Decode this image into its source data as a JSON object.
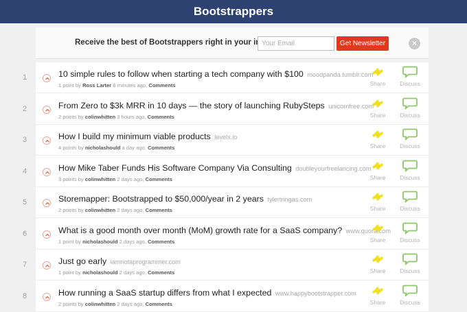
{
  "header": {
    "title": "Bootstrappers"
  },
  "newsletter": {
    "text": "Receive the best of Bootstrappers right in your inbox",
    "email_placeholder": "Your Email",
    "button_label": "Get Newsletter",
    "close_glyph": "×"
  },
  "actions": {
    "share_label": "Share",
    "discuss_label": "Discuss"
  },
  "colors": {
    "header_bg": "#2e4272",
    "newsletter_button": "#e03a1e",
    "share_icon": "#f0e020",
    "discuss_icon": "#8dc76a",
    "upvote_icon": "#e3623f"
  },
  "icons": {
    "upvote": "chevron-up-icon",
    "share": "share-arrows-icon",
    "discuss": "speech-bubble-icon",
    "close": "close-icon"
  },
  "posts": [
    {
      "rank": "1",
      "title": "10 simple rules to follow when starting a tech company with $100",
      "domain": "moodpanda.tumblr.com",
      "points": "1 point by",
      "author": "Ross Larter",
      "time": "6 minutes ago",
      "comments": "Comments"
    },
    {
      "rank": "2",
      "title": "From Zero to $3k MRR in 10 days — the story of launching RubySteps",
      "domain": "unicornfree.com",
      "points": "2 points by",
      "author": "colinwhitten",
      "time": "3 hours ago",
      "comments": "Comments"
    },
    {
      "rank": "3",
      "title": "How I build my minimum viable products",
      "domain": "levels.io",
      "points": "4 points by",
      "author": "nicholashould",
      "time": "a day ago",
      "comments": "Comments"
    },
    {
      "rank": "4",
      "title": "How Mike Taber Funds His Software Company Via Consulting",
      "domain": "doubleyourfreelancing.com",
      "points": "3 points by",
      "author": "colinwhitten",
      "time": "2 days ago",
      "comments": "Comments"
    },
    {
      "rank": "5",
      "title": "Storemapper: Bootstrapped to $50,000/year in 2 years",
      "domain": "tylertringas.com",
      "points": "2 points by",
      "author": "colinwhitten",
      "time": "2 days ago",
      "comments": "Comments"
    },
    {
      "rank": "6",
      "title": "What is a good month over month (MoM) growth rate for a SaaS company?",
      "domain": "www.quora.com",
      "points": "1 point by",
      "author": "nicholashould",
      "time": "2 days ago",
      "comments": "Comments"
    },
    {
      "rank": "7",
      "title": "Just go early",
      "domain": "iamnotaprogrammer.com",
      "points": "1 point by",
      "author": "nicholashould",
      "time": "2 days ago",
      "comments": "Comments"
    },
    {
      "rank": "8",
      "title": "How running a SaaS startup differs from what I expected",
      "domain": "www.happybootstrapper.com",
      "points": "2 points by",
      "author": "colinwhitten",
      "time": "2 days ago",
      "comments": "Comments"
    }
  ]
}
